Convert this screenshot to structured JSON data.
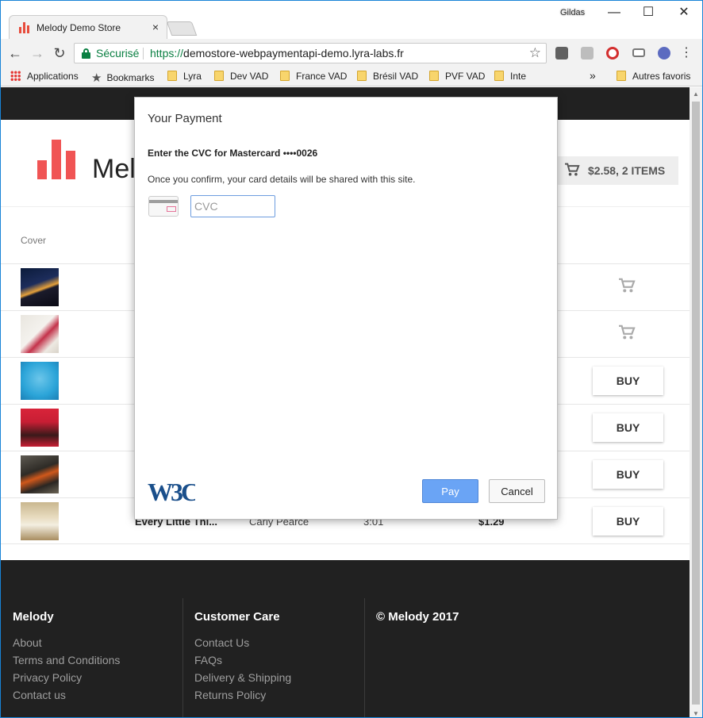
{
  "browser": {
    "tab_title": "Melody Demo Store",
    "tab_close": "×",
    "user_label": "Gildas",
    "window_buttons": {
      "minimize": "—",
      "maximize": "☐",
      "close": "✕"
    },
    "nav": {
      "back": "←",
      "forward": "→",
      "reload": "↻"
    },
    "secure_label": "Sécurisé",
    "url_scheme": "https://",
    "url_host": "demostore-webpaymentapi-demo.lyra-labs.fr",
    "star": "☆",
    "overflow": "»",
    "bookmarks": [
      {
        "label": "Applications",
        "icon": "apps-icon"
      },
      {
        "label": "Bookmarks",
        "icon": "star-icon"
      },
      {
        "label": "Lyra",
        "icon": "folder-icon"
      },
      {
        "label": "Dev VAD",
        "icon": "folder-icon"
      },
      {
        "label": "France VAD",
        "icon": "folder-icon"
      },
      {
        "label": "Brésil VAD",
        "icon": "folder-icon"
      },
      {
        "label": "PVF VAD",
        "icon": "folder-icon"
      },
      {
        "label": "Inte",
        "icon": "folder-icon"
      },
      {
        "label": "Autres favoris",
        "icon": "folder-icon"
      }
    ],
    "colors": {
      "secure_green": "#0b8043",
      "accent": "#1883d7"
    }
  },
  "store": {
    "brand": "Mel",
    "cart_label": "$2.58, 2 ITEMS",
    "table_header_cover": "Cover",
    "buy_label": "BUY",
    "last_row": {
      "title": "Every Little Thi...",
      "artist": "Carly Pearce",
      "duration": "3:01",
      "price": "$1.29"
    },
    "colors": {
      "logo_red": "#f05454",
      "dark_bar": "#212121"
    }
  },
  "footer": {
    "col1": {
      "title": "Melody",
      "links": [
        "About",
        "Terms and Conditions",
        "Privacy Policy",
        "Contact us"
      ]
    },
    "col2": {
      "title": "Customer Care",
      "links": [
        "Contact Us",
        "FAQs",
        "Delivery & Shipping",
        "Returns Policy"
      ]
    },
    "col3": {
      "title": "© Melody 2017"
    }
  },
  "dialog": {
    "title": "Your Payment",
    "subtitle": "Enter the CVC for Mastercard  ••••0026",
    "note": "Once you confirm, your card details will be shared with this site.",
    "cvc_placeholder": "CVC",
    "logo_text": "W3C",
    "pay_label": "Pay",
    "cancel_label": "Cancel",
    "colors": {
      "pay_blue": "#6aa4f5"
    }
  }
}
